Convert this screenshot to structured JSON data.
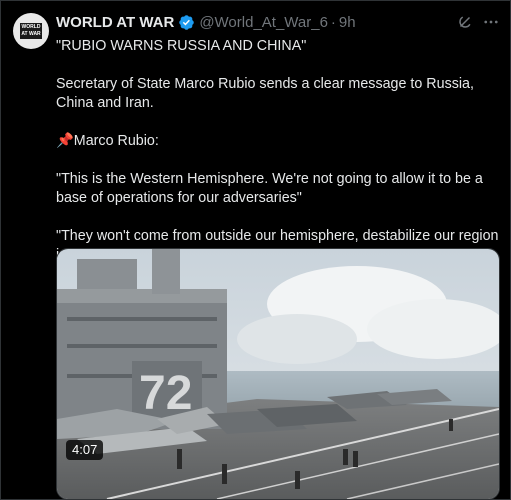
{
  "tweet": {
    "author_name": "WORLD AT WAR",
    "handle": "@World_At_War_6",
    "separator": "·",
    "timestamp": "9h",
    "avatar_text": [
      "WORLD",
      "AT WAR"
    ],
    "lines": [
      "\"RUBIO WARNS RUSSIA AND CHINA\"",
      "",
      "Secretary of State Marco Rubio sends a clear message to Russia, China and Iran.",
      "",
      "📌Marco Rubio:",
      "",
      "\"This is the Western Hemisphere. We're not going to allow it to be a base of operations for our adversaries\"",
      "",
      "\"They won't come from outside our hemisphere, destabilize our region in our own backyard\""
    ]
  },
  "media": {
    "duration": "4:07",
    "hull_number": "72"
  },
  "icons": {
    "verified": "verified-badge-icon",
    "grok": "grok-icon",
    "more": "more-icon"
  },
  "colors": {
    "background": "#000000",
    "text": "#e7e9ea",
    "muted": "#71767b",
    "verified": "#1d9bf0"
  }
}
